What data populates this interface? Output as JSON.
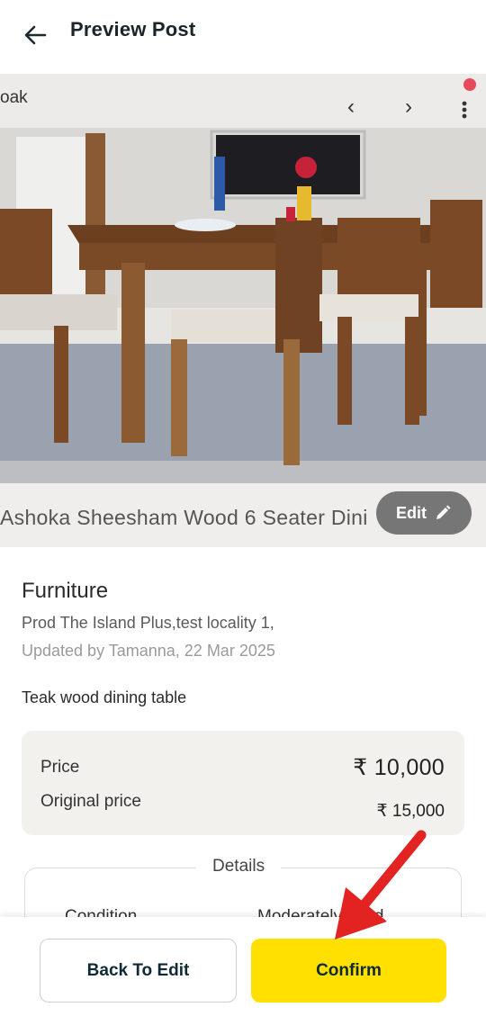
{
  "header": {
    "title": "Preview Post",
    "back_icon": "arrow-left-icon"
  },
  "photo": {
    "browser_text": "oak",
    "caption": "Ashoka Sheesham Wood 6 Seater Dini",
    "edit_label": "Edit",
    "edit_icon": "pencil-icon"
  },
  "listing": {
    "category": "Furniture",
    "location": "Prod The Island Plus,test locality 1,",
    "updated": "Updated by Tamanna, 22 Mar 2025",
    "description": "Teak wood dining table"
  },
  "pricing": {
    "price_label": "Price",
    "price_value": "₹ 10,000",
    "original_label": "Original price",
    "original_value": "₹ 15,000"
  },
  "details": {
    "title": "Details",
    "condition_label": "Condition",
    "condition_value": "Moderately used"
  },
  "actions": {
    "back_to_edit": "Back To Edit",
    "confirm": "Confirm"
  },
  "colors": {
    "confirm_bg": "#ffe000",
    "annotation_arrow": "#e32222"
  }
}
